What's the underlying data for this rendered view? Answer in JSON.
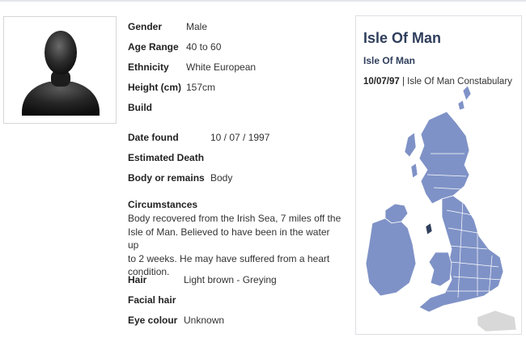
{
  "profile": {
    "gender_label": "Gender",
    "gender_value": "Male",
    "age_label": "Age Range",
    "age_value": "40 to 60",
    "ethnicity_label": "Ethnicity",
    "ethnicity_value": "White European",
    "height_label": "Height (cm)",
    "height_value": "157cm",
    "build_label": "Build",
    "date_found_label": "Date found",
    "date_found_value": "10 / 07 / 1997",
    "estimated_death_label": "Estimated Death",
    "body_label": "Body or remains",
    "body_value": "Body",
    "circumstances_label": "Circumstances",
    "circumstances_line1": "Body recovered from the Irish Sea, 7 miles off the",
    "circumstances_line2": "Isle of Man. Believed to have been in the water up",
    "circumstances_line3": "to 2 weeks. He may have suffered from a heart",
    "circumstances_line4": "condition.",
    "hair_label": "Hair",
    "hair_value": "Light brown - Greying",
    "facial_hair_label": "Facial hair",
    "eye_label": "Eye colour",
    "eye_value": "Unknown"
  },
  "location_card": {
    "title": "Isle Of Man",
    "subtitle": "Isle Of Man",
    "date": "10/07/97",
    "separator": " | ",
    "force": "Isle Of Man Constabulary"
  },
  "colors": {
    "heading": "#2f3e5c",
    "map_fill": "#7f92c7",
    "map_border": "#ffffff",
    "ireland_grey": "#d8d8d8"
  }
}
